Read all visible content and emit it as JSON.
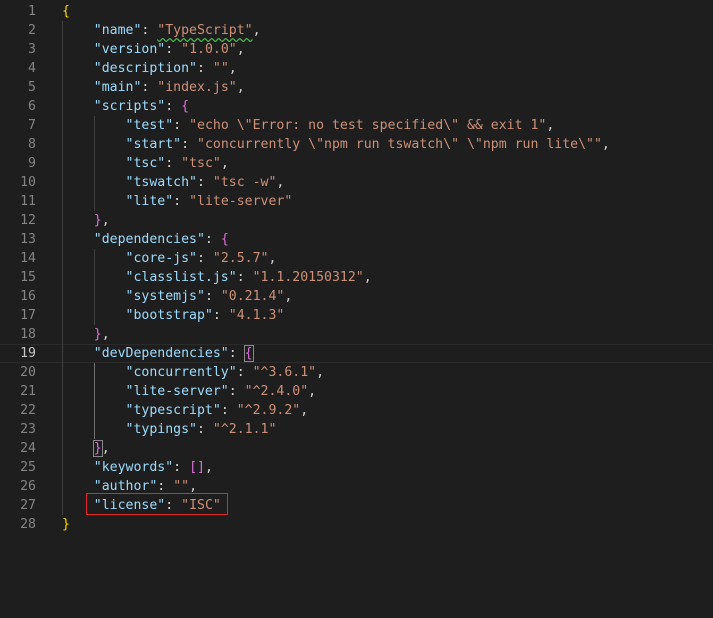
{
  "editor": {
    "lines": [
      {
        "n": "1",
        "tokens": [
          [
            "b1",
            "{"
          ]
        ]
      },
      {
        "n": "2",
        "tokens": [
          [
            "p",
            "    "
          ],
          [
            "k",
            "\"name\""
          ],
          [
            "p",
            ": "
          ],
          [
            "s",
            "\"TypeScript\"",
            "sq"
          ],
          [
            "p",
            ","
          ]
        ]
      },
      {
        "n": "3",
        "tokens": [
          [
            "p",
            "    "
          ],
          [
            "k",
            "\"version\""
          ],
          [
            "p",
            ": "
          ],
          [
            "s",
            "\"1.0.0\""
          ],
          [
            "p",
            ","
          ]
        ]
      },
      {
        "n": "4",
        "tokens": [
          [
            "p",
            "    "
          ],
          [
            "k",
            "\"description\""
          ],
          [
            "p",
            ": "
          ],
          [
            "s",
            "\"\""
          ],
          [
            "p",
            ","
          ]
        ]
      },
      {
        "n": "5",
        "tokens": [
          [
            "p",
            "    "
          ],
          [
            "k",
            "\"main\""
          ],
          [
            "p",
            ": "
          ],
          [
            "s",
            "\"index.js\""
          ],
          [
            "p",
            ","
          ]
        ]
      },
      {
        "n": "6",
        "tokens": [
          [
            "p",
            "    "
          ],
          [
            "k",
            "\"scripts\""
          ],
          [
            "p",
            ": "
          ],
          [
            "b2",
            "{"
          ]
        ]
      },
      {
        "n": "7",
        "tokens": [
          [
            "p",
            "        "
          ],
          [
            "k",
            "\"test\""
          ],
          [
            "p",
            ": "
          ],
          [
            "s",
            "\"echo \\\"Error: no test specified\\\" && exit 1\""
          ],
          [
            "p",
            ","
          ]
        ]
      },
      {
        "n": "8",
        "tokens": [
          [
            "p",
            "        "
          ],
          [
            "k",
            "\"start\""
          ],
          [
            "p",
            ": "
          ],
          [
            "s",
            "\"concurrently \\\"npm run tswatch\\\" \\\"npm run lite\\\"\""
          ],
          [
            "p",
            ","
          ]
        ]
      },
      {
        "n": "9",
        "tokens": [
          [
            "p",
            "        "
          ],
          [
            "k",
            "\"tsc\""
          ],
          [
            "p",
            ": "
          ],
          [
            "s",
            "\"tsc\""
          ],
          [
            "p",
            ","
          ]
        ]
      },
      {
        "n": "10",
        "tokens": [
          [
            "p",
            "        "
          ],
          [
            "k",
            "\"tswatch\""
          ],
          [
            "p",
            ": "
          ],
          [
            "s",
            "\"tsc -w\""
          ],
          [
            "p",
            ","
          ]
        ]
      },
      {
        "n": "11",
        "tokens": [
          [
            "p",
            "        "
          ],
          [
            "k",
            "\"lite\""
          ],
          [
            "p",
            ": "
          ],
          [
            "s",
            "\"lite-server\""
          ]
        ]
      },
      {
        "n": "12",
        "tokens": [
          [
            "p",
            "    "
          ],
          [
            "b2",
            "}"
          ],
          [
            "p",
            ","
          ]
        ]
      },
      {
        "n": "13",
        "tokens": [
          [
            "p",
            "    "
          ],
          [
            "k",
            "\"dependencies\""
          ],
          [
            "p",
            ": "
          ],
          [
            "b2",
            "{"
          ]
        ]
      },
      {
        "n": "14",
        "tokens": [
          [
            "p",
            "        "
          ],
          [
            "k",
            "\"core-js\""
          ],
          [
            "p",
            ": "
          ],
          [
            "s",
            "\"2.5.7\""
          ],
          [
            "p",
            ","
          ]
        ]
      },
      {
        "n": "15",
        "tokens": [
          [
            "p",
            "        "
          ],
          [
            "k",
            "\"classlist.js\""
          ],
          [
            "p",
            ": "
          ],
          [
            "s",
            "\"1.1.20150312\""
          ],
          [
            "p",
            ","
          ]
        ]
      },
      {
        "n": "16",
        "tokens": [
          [
            "p",
            "        "
          ],
          [
            "k",
            "\"systemjs\""
          ],
          [
            "p",
            ": "
          ],
          [
            "s",
            "\"0.21.4\""
          ],
          [
            "p",
            ","
          ]
        ]
      },
      {
        "n": "17",
        "tokens": [
          [
            "p",
            "        "
          ],
          [
            "k",
            "\"bootstrap\""
          ],
          [
            "p",
            ": "
          ],
          [
            "s",
            "\"4.1.3\""
          ]
        ]
      },
      {
        "n": "18",
        "tokens": [
          [
            "p",
            "    "
          ],
          [
            "b2",
            "}"
          ],
          [
            "p",
            ","
          ]
        ]
      },
      {
        "n": "19",
        "tokens": [
          [
            "p",
            "    "
          ],
          [
            "k",
            "\"devDependencies\""
          ],
          [
            "p",
            ": "
          ],
          [
            "b2",
            "{",
            "box"
          ]
        ],
        "active": true
      },
      {
        "n": "20",
        "tokens": [
          [
            "p",
            "        "
          ],
          [
            "k",
            "\"concurrently\""
          ],
          [
            "p",
            ": "
          ],
          [
            "s",
            "\"^3.6.1\""
          ],
          [
            "p",
            ","
          ]
        ]
      },
      {
        "n": "21",
        "tokens": [
          [
            "p",
            "        "
          ],
          [
            "k",
            "\"lite-server\""
          ],
          [
            "p",
            ": "
          ],
          [
            "s",
            "\"^2.4.0\""
          ],
          [
            "p",
            ","
          ]
        ]
      },
      {
        "n": "22",
        "tokens": [
          [
            "p",
            "        "
          ],
          [
            "k",
            "\"typescript\""
          ],
          [
            "p",
            ": "
          ],
          [
            "s",
            "\"^2.9.2\""
          ],
          [
            "p",
            ","
          ]
        ]
      },
      {
        "n": "23",
        "tokens": [
          [
            "p",
            "        "
          ],
          [
            "k",
            "\"typings\""
          ],
          [
            "p",
            ": "
          ],
          [
            "s",
            "\"^2.1.1\""
          ]
        ]
      },
      {
        "n": "24",
        "tokens": [
          [
            "p",
            "    "
          ],
          [
            "b2",
            "}",
            "box"
          ],
          [
            "p",
            ","
          ]
        ]
      },
      {
        "n": "25",
        "tokens": [
          [
            "p",
            "    "
          ],
          [
            "k",
            "\"keywords\""
          ],
          [
            "p",
            ": "
          ],
          [
            "b2",
            "[]"
          ],
          [
            "p",
            ","
          ]
        ]
      },
      {
        "n": "26",
        "tokens": [
          [
            "p",
            "    "
          ],
          [
            "k",
            "\"author\""
          ],
          [
            "p",
            ": "
          ],
          [
            "s",
            "\"\""
          ],
          [
            "p",
            ","
          ]
        ]
      },
      {
        "n": "27",
        "tokens": [
          [
            "p",
            "    "
          ],
          [
            "k",
            "\"license\""
          ],
          [
            "p",
            ": "
          ],
          [
            "s",
            "\"ISC\""
          ]
        ]
      },
      {
        "n": "28",
        "tokens": [
          [
            "b1",
            "}"
          ]
        ]
      }
    ]
  },
  "colors": {
    "background": "#1e1e1e",
    "key": "#9cdcfe",
    "string": "#ce9178",
    "bracket_outer": "#ffd700",
    "bracket_inner": "#da70d6",
    "highlight_border": "#e0262a"
  }
}
